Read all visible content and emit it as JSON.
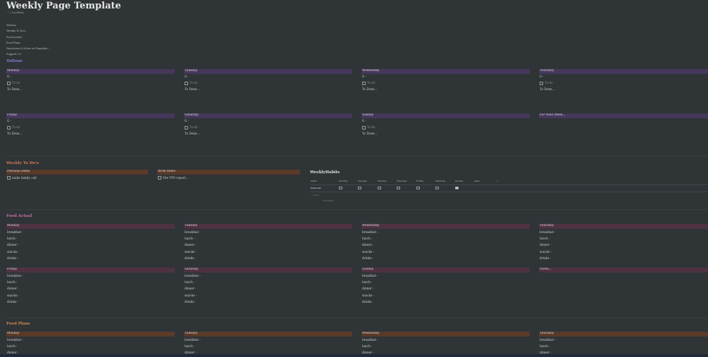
{
  "page": {
    "title": "Weekly Page Template",
    "backlinks": "2 backlinks",
    "toc": [
      "ToDone",
      "Weekly To Do's",
      "Food Actual",
      "Food Plans",
      "Directions & Notes on Template...",
      "Support Us"
    ]
  },
  "icons": {
    "backlinks": "arrow-icon",
    "checkbox": "checkbox-icon"
  },
  "colors": {
    "todone_section": "#8f79cf",
    "weekly_section": "#d27a55",
    "food_actual_section": "#c46fa2",
    "food_plans_section": "#d08a4a",
    "todone_header": "#45385a",
    "food_actual_header": "#4e3242",
    "food_plans_header": "#5a3a29"
  },
  "todone": {
    "title": "ToDone",
    "days": [
      {
        "name": "Monday",
        "g": "G -",
        "todo": "To-do",
        "done": "To Done..."
      },
      {
        "name": "Tuesday",
        "g": "G -",
        "todo": "To-do",
        "done": "To Done..."
      },
      {
        "name": "Wednesday",
        "g": "G -",
        "todo": "To-do",
        "done": "To Done..."
      },
      {
        "name": "Thursday",
        "g": "G -",
        "todo": "To-do",
        "done": "To Done..."
      },
      {
        "name": "Friday",
        "g": "G -",
        "todo": "To-do",
        "done": "To Done..."
      },
      {
        "name": "Saturday",
        "g": "G -",
        "todo": "To-do",
        "done": "To Done..."
      },
      {
        "name": "Sunday",
        "g": "G -",
        "todo": "To-do",
        "done": "To Done..."
      }
    ],
    "next_week": "For Next Week..."
  },
  "weekly": {
    "title": "Weekly To Do's",
    "personal": {
      "header": "Personal Items",
      "item": "make family call"
    },
    "work": {
      "header": "Work Items",
      "item": "File TPS report..."
    }
  },
  "habits": {
    "title": "WeeklyHabits",
    "columns": [
      "Habit",
      "Monday",
      "Tuesday",
      "Wednes...",
      "Thursday",
      "Friday",
      "Saturday",
      "Sunday",
      "state"
    ],
    "add_column": "+",
    "row": {
      "habit": "Exercise",
      "checked": [
        false,
        false,
        false,
        false,
        false,
        false,
        true
      ]
    },
    "new_label": "+ New",
    "calculate": "Calculate ~"
  },
  "food_actual": {
    "title": "Food Actual",
    "days": [
      "Monday",
      "Tuesday",
      "Wednesday",
      "Thursday",
      "Friday",
      "Saturday",
      "Sunday"
    ],
    "notes": "Notes...",
    "meals": [
      "breakfast -",
      "lunch -",
      "dinner -",
      "snacks -",
      "drinks -"
    ]
  },
  "food_plans": {
    "title": "Food Plans",
    "days": [
      "Monday",
      "Tuesday",
      "Wednesday",
      "Thursday"
    ],
    "meals": [
      "breakfast -",
      "lunch -",
      "dinner -"
    ]
  }
}
